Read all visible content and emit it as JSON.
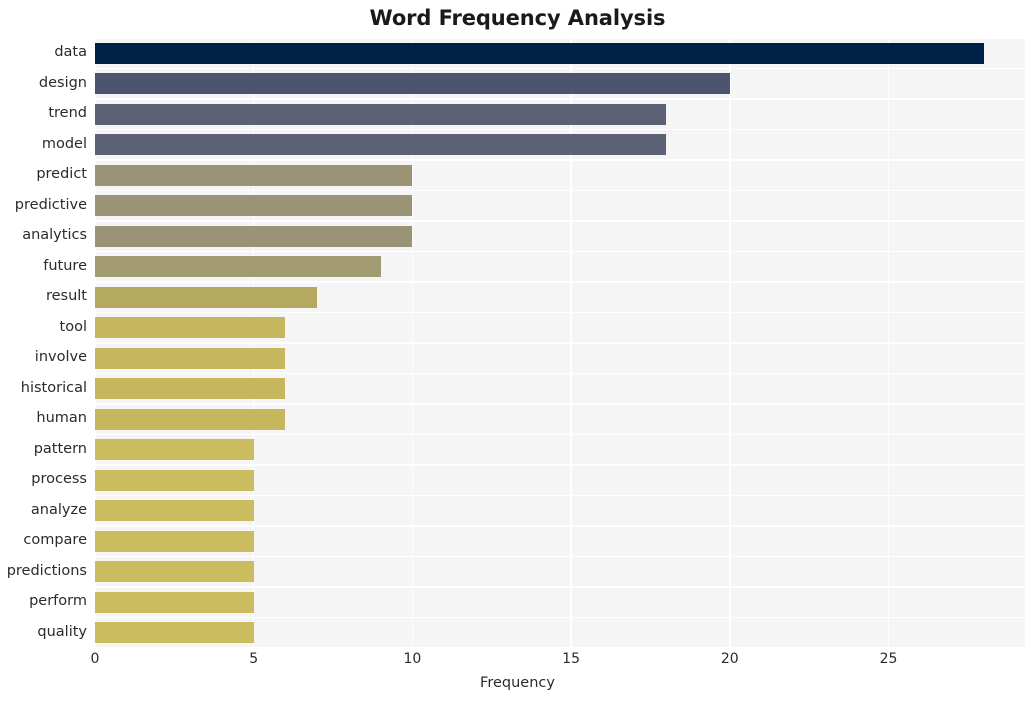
{
  "chart_data": {
    "type": "bar",
    "orientation": "horizontal",
    "title": "Word Frequency Analysis",
    "xlabel": "Frequency",
    "ylabel": "",
    "xlim": [
      0,
      29.3
    ],
    "xticks": [
      0,
      5,
      10,
      15,
      20,
      25
    ],
    "xtick_labels": [
      "0",
      "5",
      "10",
      "15",
      "20",
      "25"
    ],
    "grid": true,
    "legend": null,
    "categories": [
      "data",
      "design",
      "trend",
      "model",
      "predict",
      "predictive",
      "analytics",
      "future",
      "result",
      "tool",
      "involve",
      "historical",
      "human",
      "pattern",
      "process",
      "analyze",
      "compare",
      "predictions",
      "perform",
      "quality"
    ],
    "values": [
      28,
      20,
      18,
      18,
      10,
      10,
      10,
      9,
      7,
      6,
      6,
      6,
      6,
      5,
      5,
      5,
      5,
      5,
      5,
      5
    ],
    "bar_colors": [
      "#002147",
      "#4d5470",
      "#5c6175",
      "#5c6175",
      "#9b9375",
      "#9b9375",
      "#9b9375",
      "#a29a70",
      "#b5a95f",
      "#c6b75e",
      "#c6b75e",
      "#c6b75e",
      "#c6b75e",
      "#cbbc60",
      "#cbbc60",
      "#cbbc60",
      "#cbbc60",
      "#cbbc60",
      "#cbbc60",
      "#cbbc60"
    ]
  },
  "style": {
    "figure_background": "#ffffff",
    "plot_background": "#f5f5f6",
    "gridline_color": "#ffffff",
    "text_color": "#2b2b2b",
    "title_color": "#1a1a1a"
  }
}
